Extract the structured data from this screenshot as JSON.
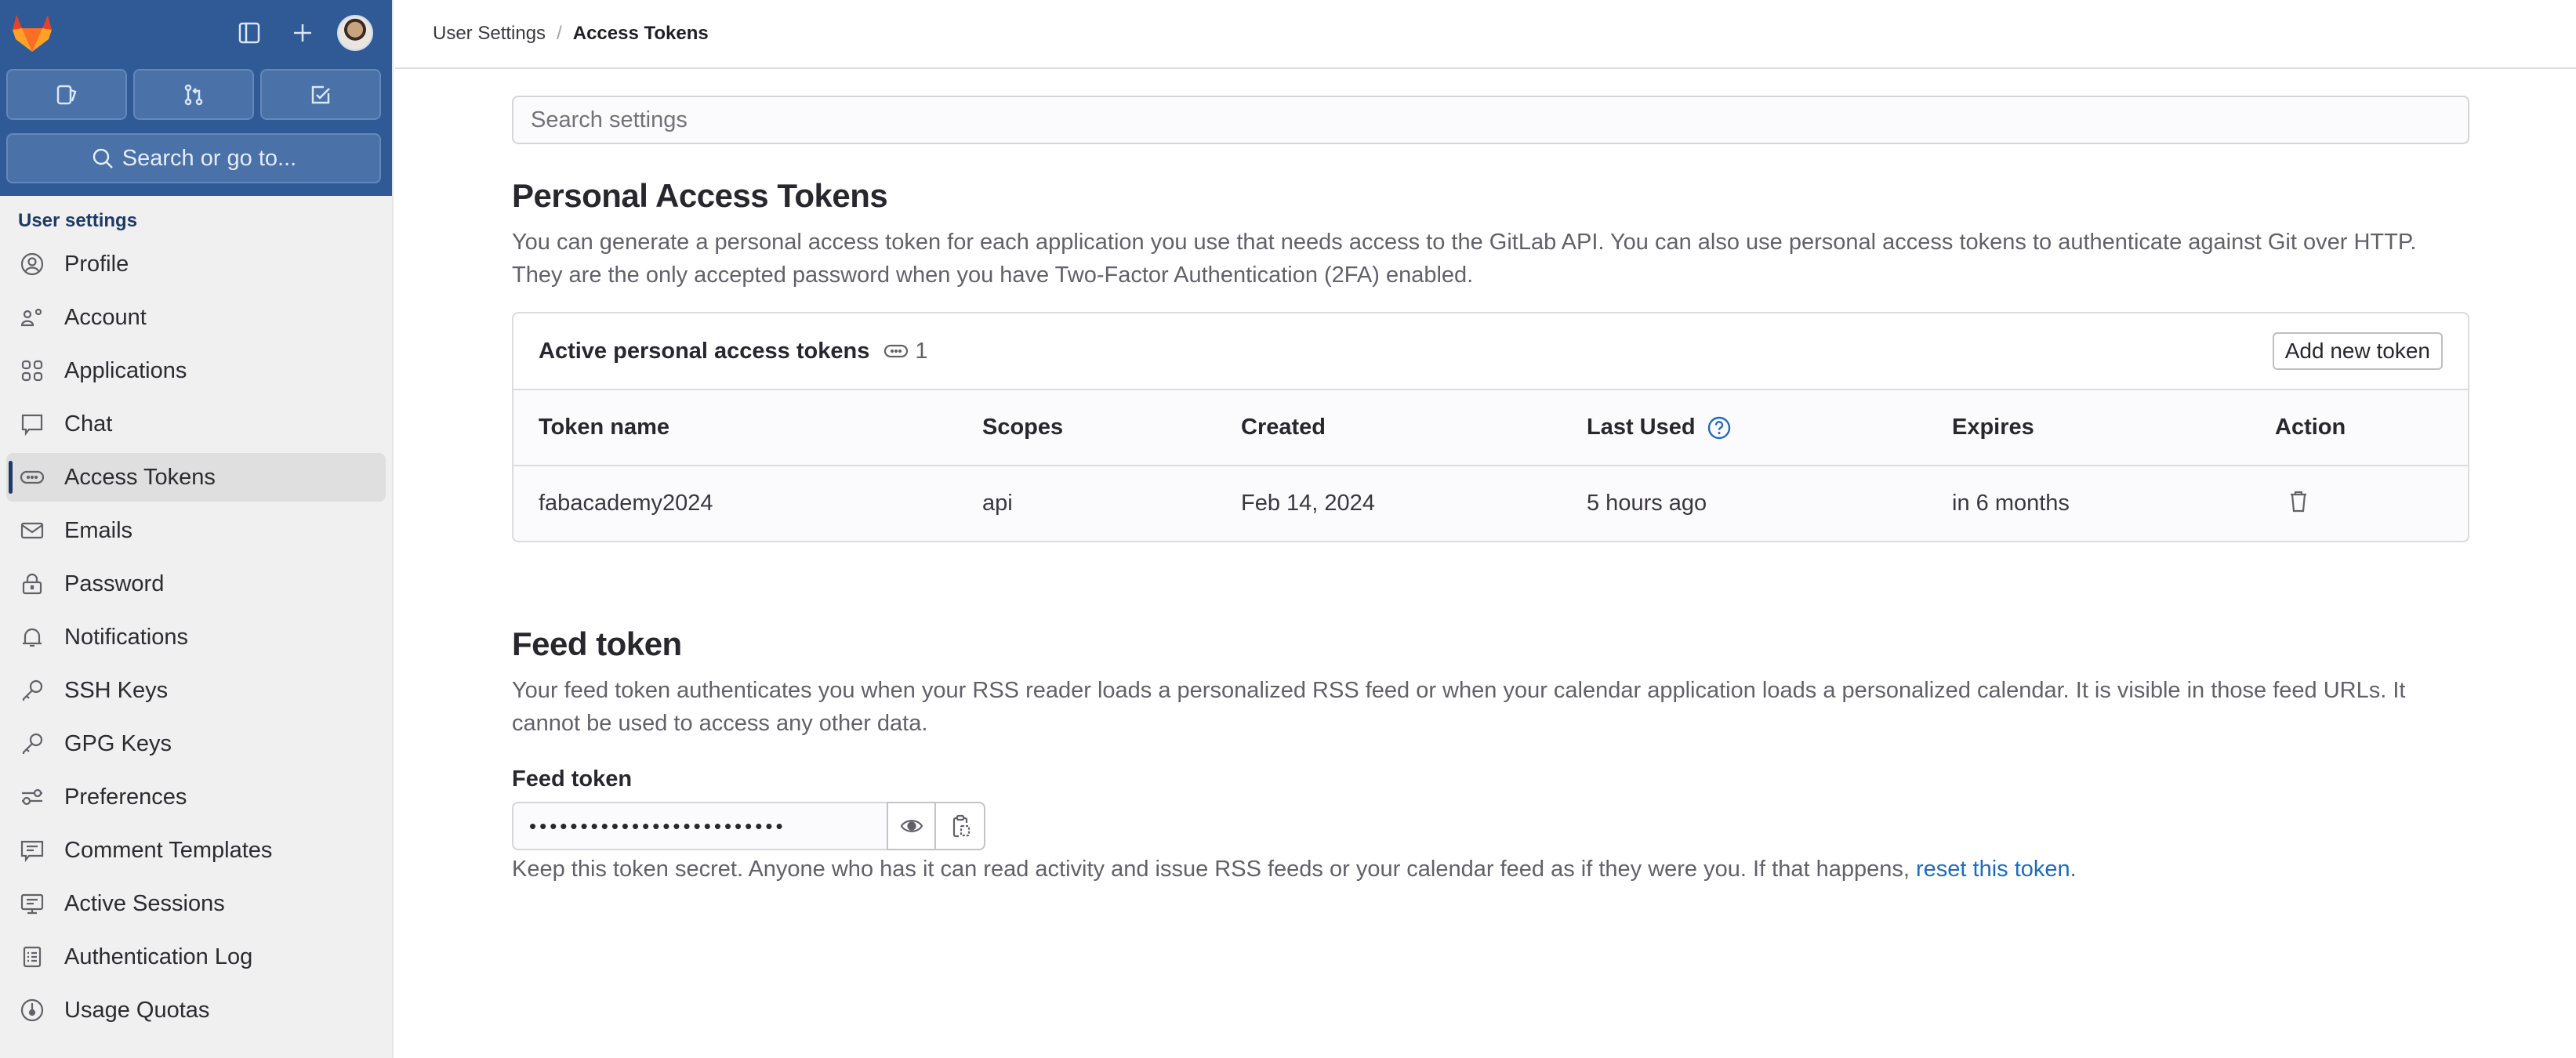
{
  "sidebar": {
    "top": {
      "logo": "gitlab-logo",
      "panel_toggle_icon": "sidebar-toggle-icon",
      "create_icon": "plus-icon",
      "avatar_alt": "user-avatar"
    },
    "quick_actions": [
      {
        "name": "issues",
        "icon": "issues-icon"
      },
      {
        "name": "merge-requests",
        "icon": "merge-request-icon"
      },
      {
        "name": "todos",
        "icon": "todo-checkbox-icon"
      }
    ],
    "search_label": "Search or go to...",
    "section_title": "User settings",
    "items": [
      {
        "label": "Profile",
        "icon": "profile-icon",
        "active": false
      },
      {
        "label": "Account",
        "icon": "account-icon",
        "active": false
      },
      {
        "label": "Applications",
        "icon": "applications-icon",
        "active": false
      },
      {
        "label": "Chat",
        "icon": "chat-icon",
        "active": false
      },
      {
        "label": "Access Tokens",
        "icon": "token-icon",
        "active": true
      },
      {
        "label": "Emails",
        "icon": "email-icon",
        "active": false
      },
      {
        "label": "Password",
        "icon": "lock-icon",
        "active": false
      },
      {
        "label": "Notifications",
        "icon": "bell-icon",
        "active": false
      },
      {
        "label": "SSH Keys",
        "icon": "key-icon",
        "active": false
      },
      {
        "label": "GPG Keys",
        "icon": "key-icon",
        "active": false
      },
      {
        "label": "Preferences",
        "icon": "preferences-icon",
        "active": false
      },
      {
        "label": "Comment Templates",
        "icon": "comment-template-icon",
        "active": false
      },
      {
        "label": "Active Sessions",
        "icon": "monitor-icon",
        "active": false
      },
      {
        "label": "Authentication Log",
        "icon": "log-icon",
        "active": false
      },
      {
        "label": "Usage Quotas",
        "icon": "quota-icon",
        "active": false
      }
    ]
  },
  "breadcrumb": {
    "parent": "User Settings",
    "separator": "/",
    "current": "Access Tokens"
  },
  "search": {
    "placeholder": "Search settings",
    "value": ""
  },
  "pat": {
    "title": "Personal Access Tokens",
    "description_line1": "You can generate a personal access token for each application you use that needs access to the GitLab API. You can also use personal access tokens to authenticate against Git over HTTP.",
    "description_line2": "They are the only accepted password when you have Two-Factor Authentication (2FA) enabled.",
    "card": {
      "title": "Active personal access tokens",
      "count": "1",
      "add_button": "Add new token",
      "columns": [
        "Token name",
        "Scopes",
        "Created",
        "Last Used",
        "Expires",
        "Action"
      ],
      "rows": [
        {
          "name": "fabacademy2024",
          "scopes": "api",
          "created": "Feb 14, 2024",
          "last_used": "5 hours ago",
          "expires": "in 6 months",
          "action_icon": "trash-icon"
        }
      ]
    }
  },
  "feed": {
    "title": "Feed token",
    "description_line1": "Your feed token authenticates you when your RSS reader loads a personalized RSS feed or when your calendar application loads a personalized calendar. It is visible in those feed URLs. It",
    "description_line2": "cannot be used to access any other data.",
    "label": "Feed token",
    "masked_value": "•••••••••••••••••••••••••",
    "help_text": "Keep this token secret. Anyone who has it can read activity and issue RSS feeds or your calendar feed as if they were you. If that happens, ",
    "help_link": "reset this token",
    "help_suffix": "."
  },
  "colors": {
    "nav_blue": "#2f5a96",
    "sidebar_bg": "#f0f0f0",
    "active_indicator": "#1f3a64",
    "link": "#1f6bb8"
  }
}
